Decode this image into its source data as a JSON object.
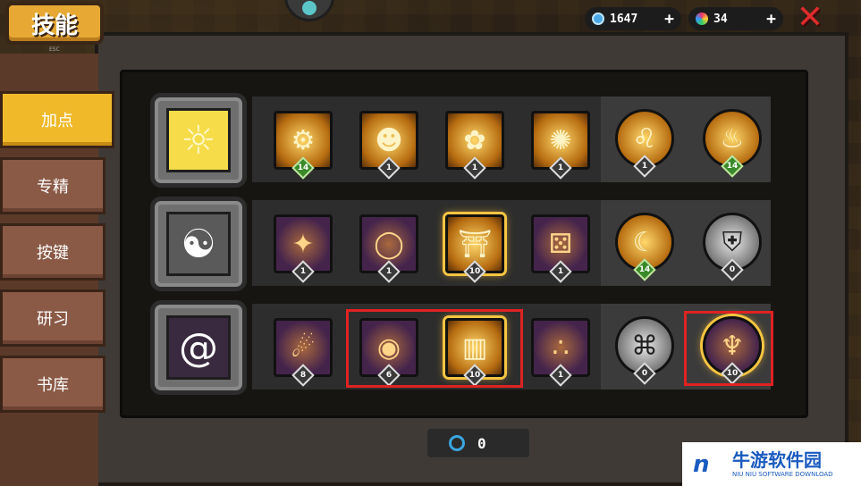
{
  "header": {
    "title": "技能",
    "esc_hint": "ESC",
    "gems": "1647",
    "crystals": "34",
    "plus": "+",
    "close": "✕"
  },
  "sidebar": {
    "items": [
      {
        "label": "加点",
        "active": true
      },
      {
        "label": "专精",
        "active": false
      },
      {
        "label": "按键",
        "active": false
      },
      {
        "label": "研习",
        "active": false
      },
      {
        "label": "书库",
        "active": false
      }
    ]
  },
  "rows": [
    {
      "element": "light",
      "icon": "sun-icon",
      "skills": [
        {
          "icon": "gears-icon",
          "level": "14",
          "shape": "square",
          "style": "gold",
          "green": true
        },
        {
          "icon": "golem-icon",
          "level": "1",
          "shape": "square",
          "style": "gold"
        },
        {
          "icon": "flower-icon",
          "level": "1",
          "shape": "square",
          "style": "gold"
        },
        {
          "icon": "sigil-icon",
          "level": "1",
          "shape": "square",
          "style": "gold"
        },
        {
          "icon": "lion-icon",
          "level": "1",
          "shape": "round",
          "style": "gold"
        },
        {
          "icon": "flame-icon",
          "level": "14",
          "shape": "round",
          "style": "gold",
          "green": true
        }
      ]
    },
    {
      "element": "dark",
      "icon": "yin-yang-icon",
      "skills": [
        {
          "icon": "star-blade-icon",
          "level": "1",
          "shape": "square",
          "style": "purple"
        },
        {
          "icon": "ring-icon",
          "level": "1",
          "shape": "square",
          "style": "purple"
        },
        {
          "icon": "altar-icon",
          "level": "10",
          "shape": "square",
          "style": "gold",
          "selected": true
        },
        {
          "icon": "dice-icon",
          "level": "1",
          "shape": "square",
          "style": "purple"
        },
        {
          "icon": "moon-icon",
          "level": "14",
          "shape": "round",
          "style": "gold",
          "green": true
        },
        {
          "icon": "shield-rune-icon",
          "level": "0",
          "shape": "round",
          "style": "silver"
        }
      ]
    },
    {
      "element": "void",
      "icon": "spiral-icon",
      "skills": [
        {
          "icon": "comet-icon",
          "level": "8",
          "shape": "square",
          "style": "purple"
        },
        {
          "icon": "black-hole-icon",
          "level": "6",
          "shape": "square",
          "style": "purple"
        },
        {
          "icon": "pillar-icon",
          "level": "10",
          "shape": "square",
          "style": "gold",
          "selected": true
        },
        {
          "icon": "orbs-icon",
          "level": "1",
          "shape": "square",
          "style": "purple"
        },
        {
          "icon": "rune-circle-icon",
          "level": "0",
          "shape": "round",
          "style": "silver"
        },
        {
          "icon": "octopus-icon",
          "level": "10",
          "shape": "round",
          "style": "purple",
          "selected": true
        }
      ]
    }
  ],
  "skill_points": {
    "value": "0"
  },
  "watermark": {
    "cn": "牛游软件园",
    "en": "NIU NIU SOFTWARE DOWNLOAD"
  }
}
